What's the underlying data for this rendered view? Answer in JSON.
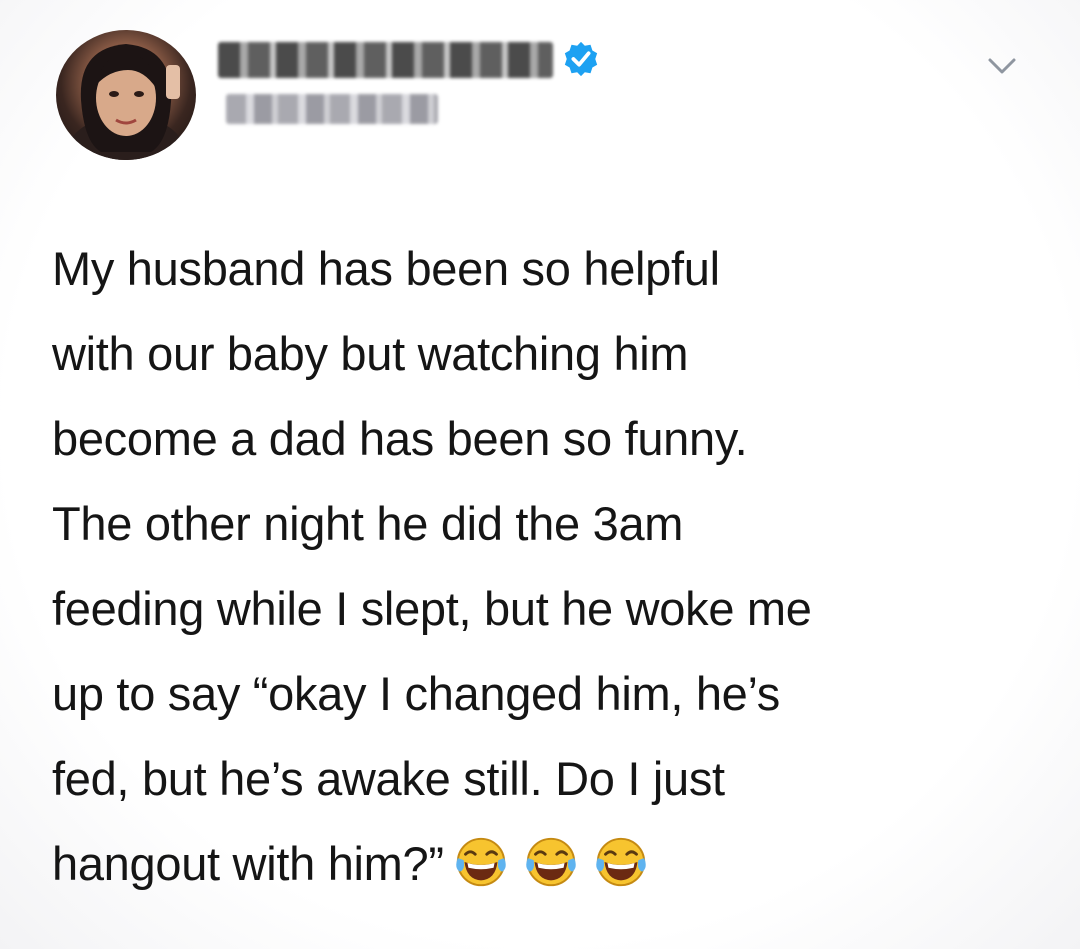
{
  "tweet": {
    "author": {
      "avatar_icon": "profile-photo",
      "name_redacted": true,
      "handle_redacted": true,
      "verified_icon": "verified-badge-icon",
      "verified_color": "#1DA1F2"
    },
    "menu_icon": "chevron-down-icon",
    "lines": [
      "My husband has been so helpful",
      "with our baby but watching him",
      "become a dad has been so funny.",
      "The other night he did the 3am",
      "feeding while I slept, but he woke me",
      "up to say “okay I changed him, he’s",
      "fed, but he’s awake still. Do I just",
      "hangout with him?”"
    ],
    "emojis": [
      "😂",
      "😂",
      "😂"
    ],
    "emoji_icon": "tears-of-joy-emoji"
  }
}
